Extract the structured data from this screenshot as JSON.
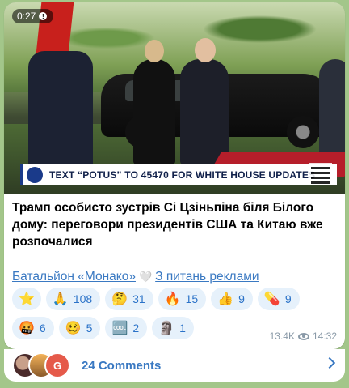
{
  "video": {
    "duration": "0:27",
    "banner_text": "TEXT “POTUS” TO 45470 FOR WHITE HOUSE UPDATES"
  },
  "post": {
    "caption": "Трамп особисто зустрів Сі Цзіньпіна біля Білого дому: переговори президентів США та Китаю вже розпочалися",
    "link_channel": "Батальйон «Монако»",
    "link_separator": "🤍",
    "link_ads": "З питань реклами"
  },
  "reactions": {
    "row1": [
      {
        "emoji": "⭐",
        "count": ""
      },
      {
        "emoji": "🙏",
        "count": "108"
      },
      {
        "emoji": "🤔",
        "count": "31"
      },
      {
        "emoji": "🔥",
        "count": "15"
      },
      {
        "emoji": "👍",
        "count": "9"
      },
      {
        "emoji": "💊",
        "count": "9"
      }
    ],
    "row2": [
      {
        "emoji": "🤬",
        "count": "6"
      },
      {
        "emoji": "🥴",
        "count": "5"
      },
      {
        "emoji": "🆒",
        "count": "2"
      },
      {
        "emoji": "🗿",
        "count": "1"
      }
    ]
  },
  "meta": {
    "views": "13.4K",
    "time": "14:32"
  },
  "comments": {
    "label": "24 Comments",
    "avatar3_letter": "G"
  },
  "colors": {
    "accent": "#3a79c2",
    "reaction_bg": "#e6f1fb",
    "chat_bg": "#a3c68a"
  }
}
